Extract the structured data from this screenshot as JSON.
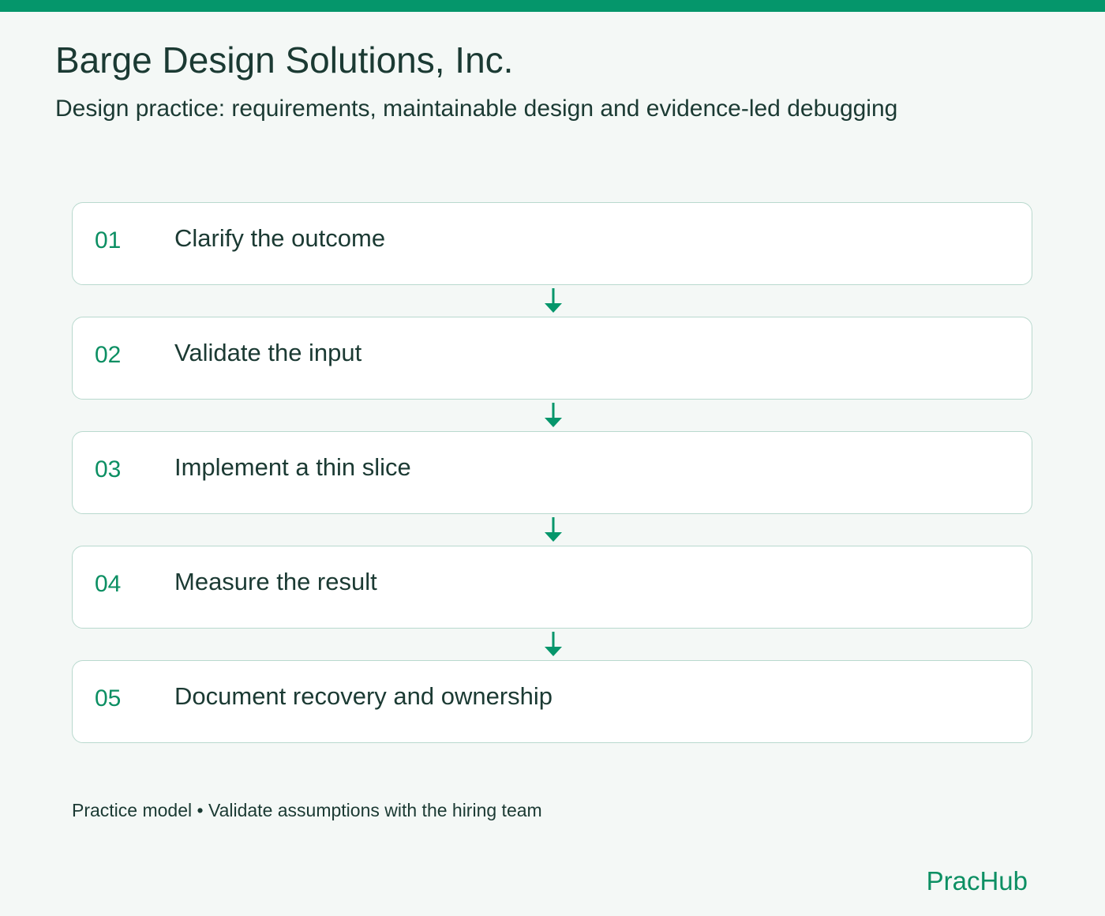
{
  "header": {
    "title": "Barge Design Solutions, Inc.",
    "subtitle": "Design practice: requirements, maintainable design and evidence-led debugging"
  },
  "steps": [
    {
      "number": "01",
      "label": "Clarify the outcome"
    },
    {
      "number": "02",
      "label": "Validate the input"
    },
    {
      "number": "03",
      "label": "Implement a thin slice"
    },
    {
      "number": "04",
      "label": "Measure the result"
    },
    {
      "number": "05",
      "label": "Document recovery and ownership"
    }
  ],
  "footer": {
    "note": "Practice model • Validate assumptions with the hiring team",
    "brand": "PracHub"
  },
  "colors": {
    "accent": "#05966b",
    "text": "#1b3a33",
    "border": "#b9d9ce",
    "background": "#f4f8f6"
  },
  "icons": {
    "connector": "arrow-down-icon"
  }
}
